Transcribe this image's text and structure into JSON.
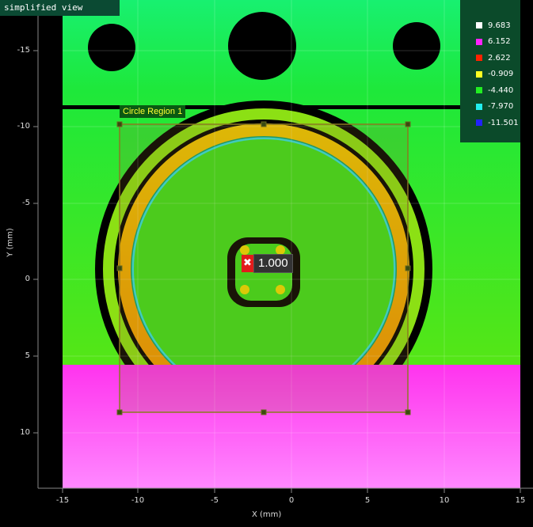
{
  "view_badge": "simplified view",
  "legend": [
    {
      "label": "9.683",
      "color": "#ffffff"
    },
    {
      "label": "6.152",
      "color": "#ff22ff"
    },
    {
      "label": "2.622",
      "color": "#ff2200"
    },
    {
      "label": "-0.909",
      "color": "#ffff22"
    },
    {
      "label": "-4.440",
      "color": "#22ee22"
    },
    {
      "label": "-7.970",
      "color": "#22eeee"
    },
    {
      "label": "-11.501",
      "color": "#2222ff"
    }
  ],
  "region": {
    "label": "Circle Region 1"
  },
  "marker": {
    "icon": "✖",
    "value": "1.000"
  },
  "axes": {
    "xlabel": "X (mm)",
    "ylabel": "Y (mm)",
    "x_ticks": [
      "-15",
      "-10",
      "-5",
      "0",
      "5",
      "10",
      "15"
    ],
    "y_ticks": [
      "-15",
      "-10",
      "-5",
      "0",
      "5",
      "10"
    ]
  }
}
